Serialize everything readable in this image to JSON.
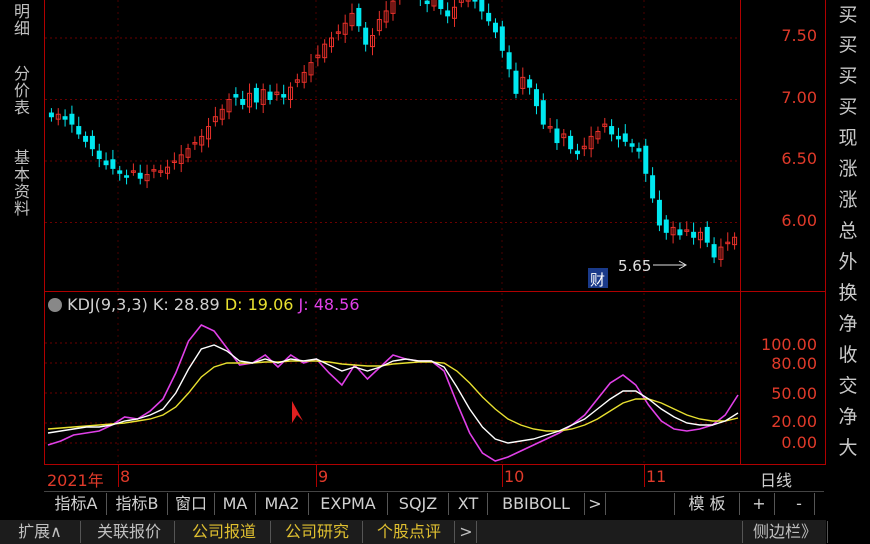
{
  "left_tabs": [
    "明细",
    "分价表",
    "基本资料"
  ],
  "price_axis": {
    "labels": [
      "7.50",
      "7.00",
      "6.50",
      "6.00"
    ],
    "values": [
      7.5,
      7.0,
      6.5,
      6.0
    ]
  },
  "indicator_axis": {
    "labels": [
      "100.00",
      "80.00",
      "50.00",
      "20.00",
      "0.00"
    ],
    "values": [
      100,
      80,
      50,
      20,
      0
    ]
  },
  "annotations": {
    "low_marker": "5.65",
    "finance_badge": "财"
  },
  "kdj": {
    "name": "KDJ(9,3,3)",
    "k_label": "K:",
    "k": "28.89",
    "d_label": "D:",
    "d": "19.06",
    "j_label": "J:",
    "j": "48.56"
  },
  "date_axis": {
    "labels": [
      "2021年",
      "8",
      "9",
      "10",
      "11"
    ],
    "period": "日线"
  },
  "indicator_tabs": [
    "指标A",
    "指标B",
    "窗口",
    "MA",
    "MA2",
    "EXPMA",
    "SQJZ",
    "XT",
    "BBIBOLL",
    ">"
  ],
  "template_label": "模 板",
  "plus": "+",
  "minus": "-",
  "bottom_tabs": [
    "扩展∧",
    "关联报价",
    "公司报道",
    "公司研究",
    "个股点评",
    ">"
  ],
  "sidebar_button": "侧边栏》",
  "right_column": [
    "买",
    "买",
    "买",
    "买",
    "现",
    "涨",
    "涨",
    "总",
    "外",
    "换",
    "净",
    "收",
    "交",
    "净",
    "大"
  ],
  "colors": {
    "up": "#e8302a",
    "down": "#00e8f0",
    "k": "#ffffff",
    "d": "#e8e030",
    "j": "#e040e8",
    "axis": "#b00000"
  }
}
